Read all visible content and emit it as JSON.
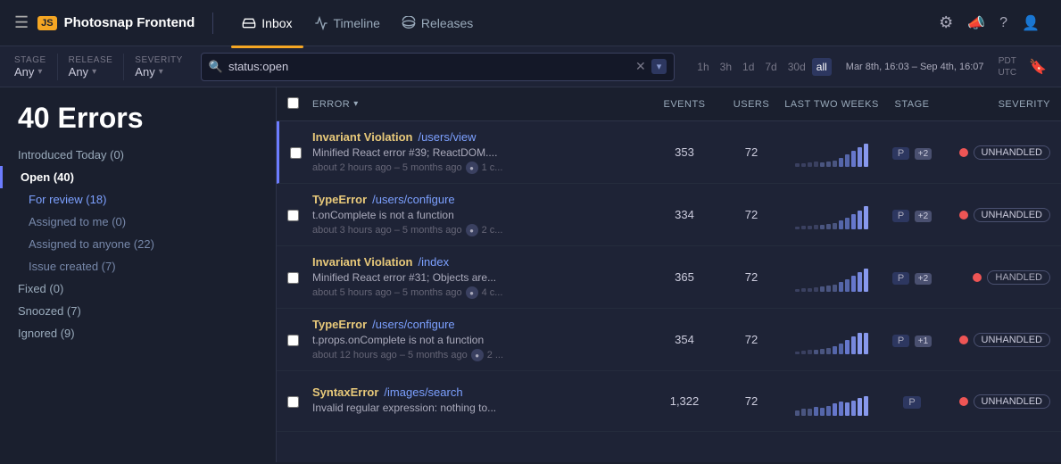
{
  "app": {
    "logo": "JS",
    "title": "Photosnap Frontend"
  },
  "nav": {
    "items": [
      {
        "id": "inbox",
        "label": "Inbox",
        "active": true,
        "icon": "inbox"
      },
      {
        "id": "timeline",
        "label": "Timeline",
        "active": false,
        "icon": "timeline"
      },
      {
        "id": "releases",
        "label": "Releases",
        "active": false,
        "icon": "releases"
      }
    ],
    "icons": [
      "gear",
      "megaphone",
      "help",
      "user"
    ]
  },
  "filters": {
    "stage": {
      "label": "STAGE",
      "value": "Any"
    },
    "release": {
      "label": "RELEASE",
      "value": "Any"
    },
    "severity": {
      "label": "SEVERITY",
      "value": "Any"
    },
    "search": {
      "value": "status:open",
      "placeholder": "status:open"
    },
    "time_options": [
      "1h",
      "3h",
      "1d",
      "7d",
      "30d",
      "all"
    ],
    "active_time": "all",
    "date_range": "Mar 8th, 16:03 – Sep 4th, 16:07",
    "tz": "PDT\nUTC"
  },
  "sidebar": {
    "error_count": "40 Errors",
    "sections": [
      {
        "id": "introduced-today",
        "label": "Introduced Today (0)",
        "active": false,
        "indent": 0
      },
      {
        "id": "open",
        "label": "Open (40)",
        "active": true,
        "indent": 0
      },
      {
        "id": "for-review",
        "label": "For review (18)",
        "active": false,
        "indent": 1
      },
      {
        "id": "assigned-to-me",
        "label": "Assigned to me (0)",
        "active": false,
        "indent": 1
      },
      {
        "id": "assigned-to-anyone",
        "label": "Assigned to anyone (22)",
        "active": false,
        "indent": 1
      },
      {
        "id": "issue-created",
        "label": "Issue created (7)",
        "active": false,
        "indent": 1
      },
      {
        "id": "fixed",
        "label": "Fixed (0)",
        "active": false,
        "indent": 0
      },
      {
        "id": "snoozed",
        "label": "Snoozed (7)",
        "active": false,
        "indent": 0
      },
      {
        "id": "ignored",
        "label": "Ignored (9)",
        "active": false,
        "indent": 0
      }
    ]
  },
  "table": {
    "headers": {
      "error": "ERROR",
      "events": "EVENTS",
      "users": "USERS",
      "last_two_weeks": "LAST TWO WEEKS",
      "stage": "STAGE",
      "severity": "SEVERITY"
    },
    "rows": [
      {
        "id": 1,
        "selected": true,
        "error_type": "Invariant Violation",
        "error_path": "/users/view",
        "error_msg": "Minified React error #39; ReactDOM....",
        "time_ago": "about 2 hours ago – 5 months ago",
        "comment_count": "1 c...",
        "events": "353",
        "users": "72",
        "stage": "P",
        "stage_badge": "+2",
        "severity_color": "#e55",
        "severity_label": "UNHANDLED",
        "bars": [
          1,
          1,
          1,
          2,
          1,
          1,
          1,
          2,
          3,
          2,
          1,
          2,
          5,
          8,
          9
        ]
      },
      {
        "id": 2,
        "selected": false,
        "error_type": "TypeError",
        "error_path": "/users/configure",
        "error_msg": "t.onComplete is not a function",
        "time_ago": "about 3 hours ago – 5 months ago",
        "comment_count": "2 c...",
        "events": "334",
        "users": "72",
        "stage": "P",
        "stage_badge": "+2",
        "severity_color": "#e55",
        "severity_label": "UNHANDLED",
        "bars": [
          1,
          1,
          1,
          1,
          2,
          1,
          1,
          2,
          2,
          3,
          3,
          4,
          6,
          7,
          8
        ]
      },
      {
        "id": 3,
        "selected": false,
        "error_type": "Invariant Violation",
        "error_path": "/index",
        "error_msg": "Minified React error #31; Objects are...",
        "time_ago": "about 5 hours ago – 5 months ago",
        "comment_count": "4 c...",
        "events": "365",
        "users": "72",
        "stage": "P",
        "stage_badge": "+2",
        "severity_color": "#e55",
        "severity_label": "HANDLED",
        "bars": [
          1,
          1,
          1,
          1,
          1,
          2,
          1,
          2,
          2,
          3,
          3,
          5,
          6,
          7,
          8
        ]
      },
      {
        "id": 4,
        "selected": false,
        "error_type": "TypeError",
        "error_path": "/users/configure",
        "error_msg": "t.props.onComplete is not a function",
        "time_ago": "about 12 hours ago – 5 months ago",
        "comment_count": "2 ...",
        "events": "354",
        "users": "72",
        "stage": "P",
        "stage_badge": "+1",
        "severity_color": "#e55",
        "severity_label": "UNHANDLED",
        "bars": [
          1,
          1,
          1,
          2,
          1,
          1,
          2,
          2,
          3,
          2,
          4,
          5,
          6,
          7,
          7
        ]
      },
      {
        "id": 5,
        "selected": false,
        "error_type": "SyntaxError",
        "error_path": "/images/search",
        "error_msg": "Invalid regular expression: nothing to...",
        "time_ago": "",
        "comment_count": "",
        "events": "1,322",
        "users": "72",
        "stage": "P",
        "stage_badge": "",
        "severity_color": "#e55",
        "severity_label": "UNHANDLED",
        "bars": [
          2,
          3,
          3,
          4,
          3,
          4,
          5,
          6,
          5,
          6,
          7,
          8,
          7,
          8,
          9
        ]
      }
    ]
  }
}
